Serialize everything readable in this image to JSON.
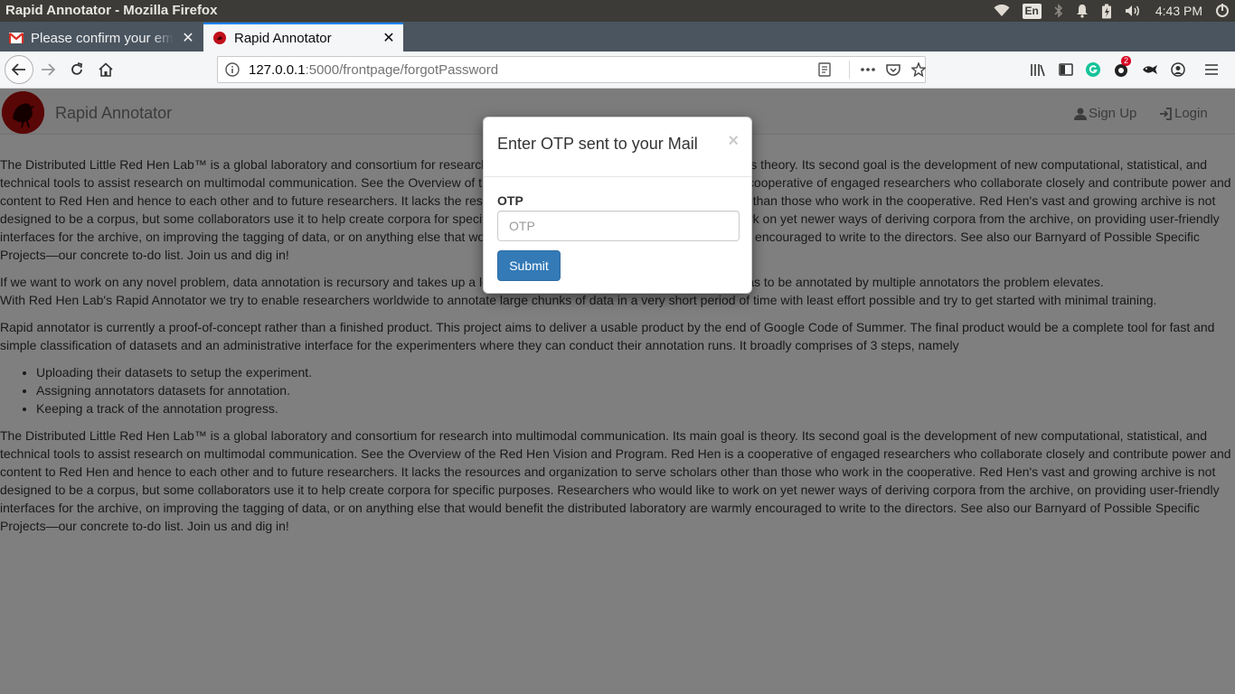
{
  "os": {
    "window_title": "Rapid Annotator - Mozilla Firefox",
    "keyboard_layout": "En",
    "clock": "4:43 PM"
  },
  "tabs": [
    {
      "label": "Please confirm your email",
      "icon": "gmail-icon",
      "active": false
    },
    {
      "label": "Rapid Annotator",
      "icon": "red-hen-icon",
      "active": true
    }
  ],
  "urlbar": {
    "host": "127.0.0.1",
    "path": ":5000/frontpage/forgotPassword"
  },
  "toolbar": {
    "notification_badge": "2"
  },
  "site": {
    "brand": "Rapid Annotator",
    "nav": {
      "signup": "Sign Up",
      "login": "Login"
    }
  },
  "content": {
    "para1": "The Distributed Little Red Hen Lab™ is a global laboratory and consortium for research into multimodal communication. Its main goal is theory. Its second goal is the development of new computational, statistical, and technical tools to assist research on multimodal communication. See the Overview of the Red Hen Vision and Program. Red Hen is a cooperative of engaged researchers who collaborate closely and contribute power and content to Red Hen and hence to each other and to future researchers. It lacks the resources and organization to serve scholars other than those who work in the cooperative. Red Hen's vast and growing archive is not designed to be a corpus, but some collaborators use it to help create corpora for specific purposes. Researchers who would like to work on yet newer ways of deriving corpora from the archive, on providing user-friendly interfaces for the archive, on improving the tagging of data, or on anything else that would benefit the distributed laboratory are warmly encouraged to write to the directors. See also our Barnyard of Possible Specific Projects—our concrete to-do list. Join us and dig in!",
    "para2a": "If we want to work on any novel problem, data annotation is recursory and takes up a lot of time and effort, and when the same data has to be annotated by multiple annotators the problem elevates.",
    "para2b": "With Red Hen Lab's Rapid Annotator we try to enable researchers worldwide to annotate large chunks of data in a very short period of time with least effort possible and try to get started with minimal training.",
    "para3": "Rapid annotator is currently a proof-of-concept rather than a finished product. This project aims to deliver a usable product by the end of Google Code of Summer. The final product would be a complete tool for fast and simple classification of datasets and an administrative interface for the experimenters where they can conduct their annotation runs. It broadly comprises of 3 steps, namely",
    "steps": [
      "Uploading their datasets to setup the experiment.",
      "Assigning annotators datasets for annotation.",
      "Keeping a track of the annotation progress."
    ],
    "para4": "The Distributed Little Red Hen Lab™ is a global laboratory and consortium for research into multimodal communication. Its main goal is theory. Its second goal is the development of new computational, statistical, and technical tools to assist research on multimodal communication. See the Overview of the Red Hen Vision and Program. Red Hen is a cooperative of engaged researchers who collaborate closely and contribute power and content to Red Hen and hence to each other and to future researchers. It lacks the resources and organization to serve scholars other than those who work in the cooperative. Red Hen's vast and growing archive is not designed to be a corpus, but some collaborators use it to help create corpora for specific purposes. Researchers who would like to work on yet newer ways of deriving corpora from the archive, on providing user-friendly interfaces for the archive, on improving the tagging of data, or on anything else that would benefit the distributed laboratory are warmly encouraged to write to the directors. See also our Barnyard of Possible Specific Projects—our concrete to-do list. Join us and dig in!"
  },
  "modal": {
    "title": "Enter OTP sent to your Mail",
    "close": "×",
    "otp_label": "OTP",
    "otp_placeholder": "OTP",
    "otp_value": "",
    "submit": "Submit"
  },
  "colors": {
    "primary_button": "#337ab7",
    "tab_accent": "#0a84ff",
    "os_bar": "#3c3b37",
    "tabstrip": "#4a5560"
  }
}
